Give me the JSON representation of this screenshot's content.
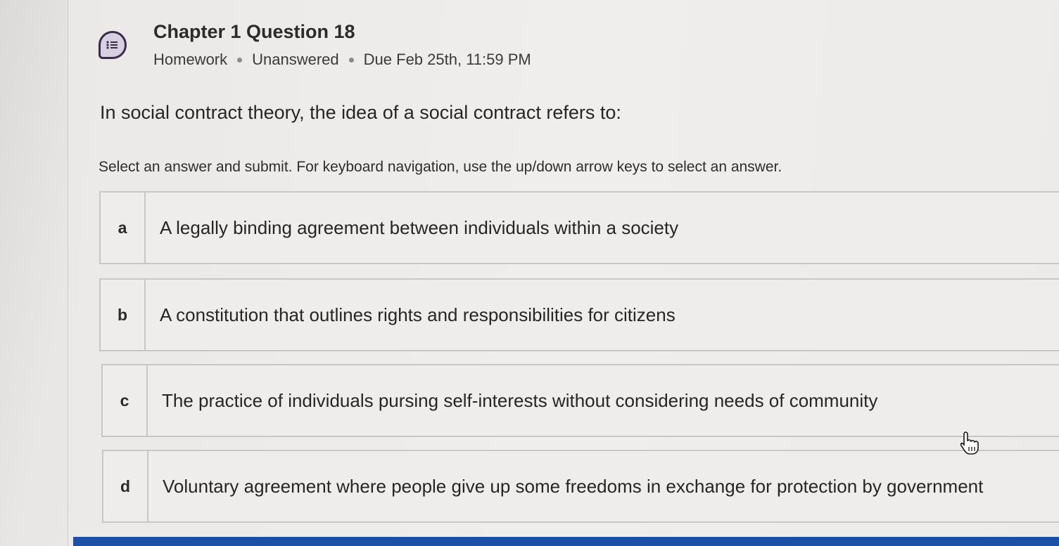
{
  "header": {
    "title": "Chapter 1 Question 18",
    "type": "Homework",
    "status": "Unanswered",
    "due": "Due Feb 25th, 11:59 PM",
    "icon": "question-list-icon"
  },
  "question": {
    "prompt": "In social contract theory, the idea of a social contract refers to:",
    "instructions": "Select an answer and submit. For keyboard navigation, use the up/down arrow keys to select an answer."
  },
  "options": [
    {
      "letter": "a",
      "text": "A legally binding agreement between individuals within a society"
    },
    {
      "letter": "b",
      "text": "A constitution that outlines rights and responsibilities for citizens"
    },
    {
      "letter": "c",
      "text": "The practice of individuals pursing self-interests without considering needs of community"
    },
    {
      "letter": "d",
      "text": "Voluntary agreement where people give up some freedoms in exchange for protection by government"
    }
  ],
  "colors": {
    "accent_bar": "#1c4fa8",
    "icon_ring": "#3a2d48",
    "icon_fill": "#d9cfe2"
  }
}
